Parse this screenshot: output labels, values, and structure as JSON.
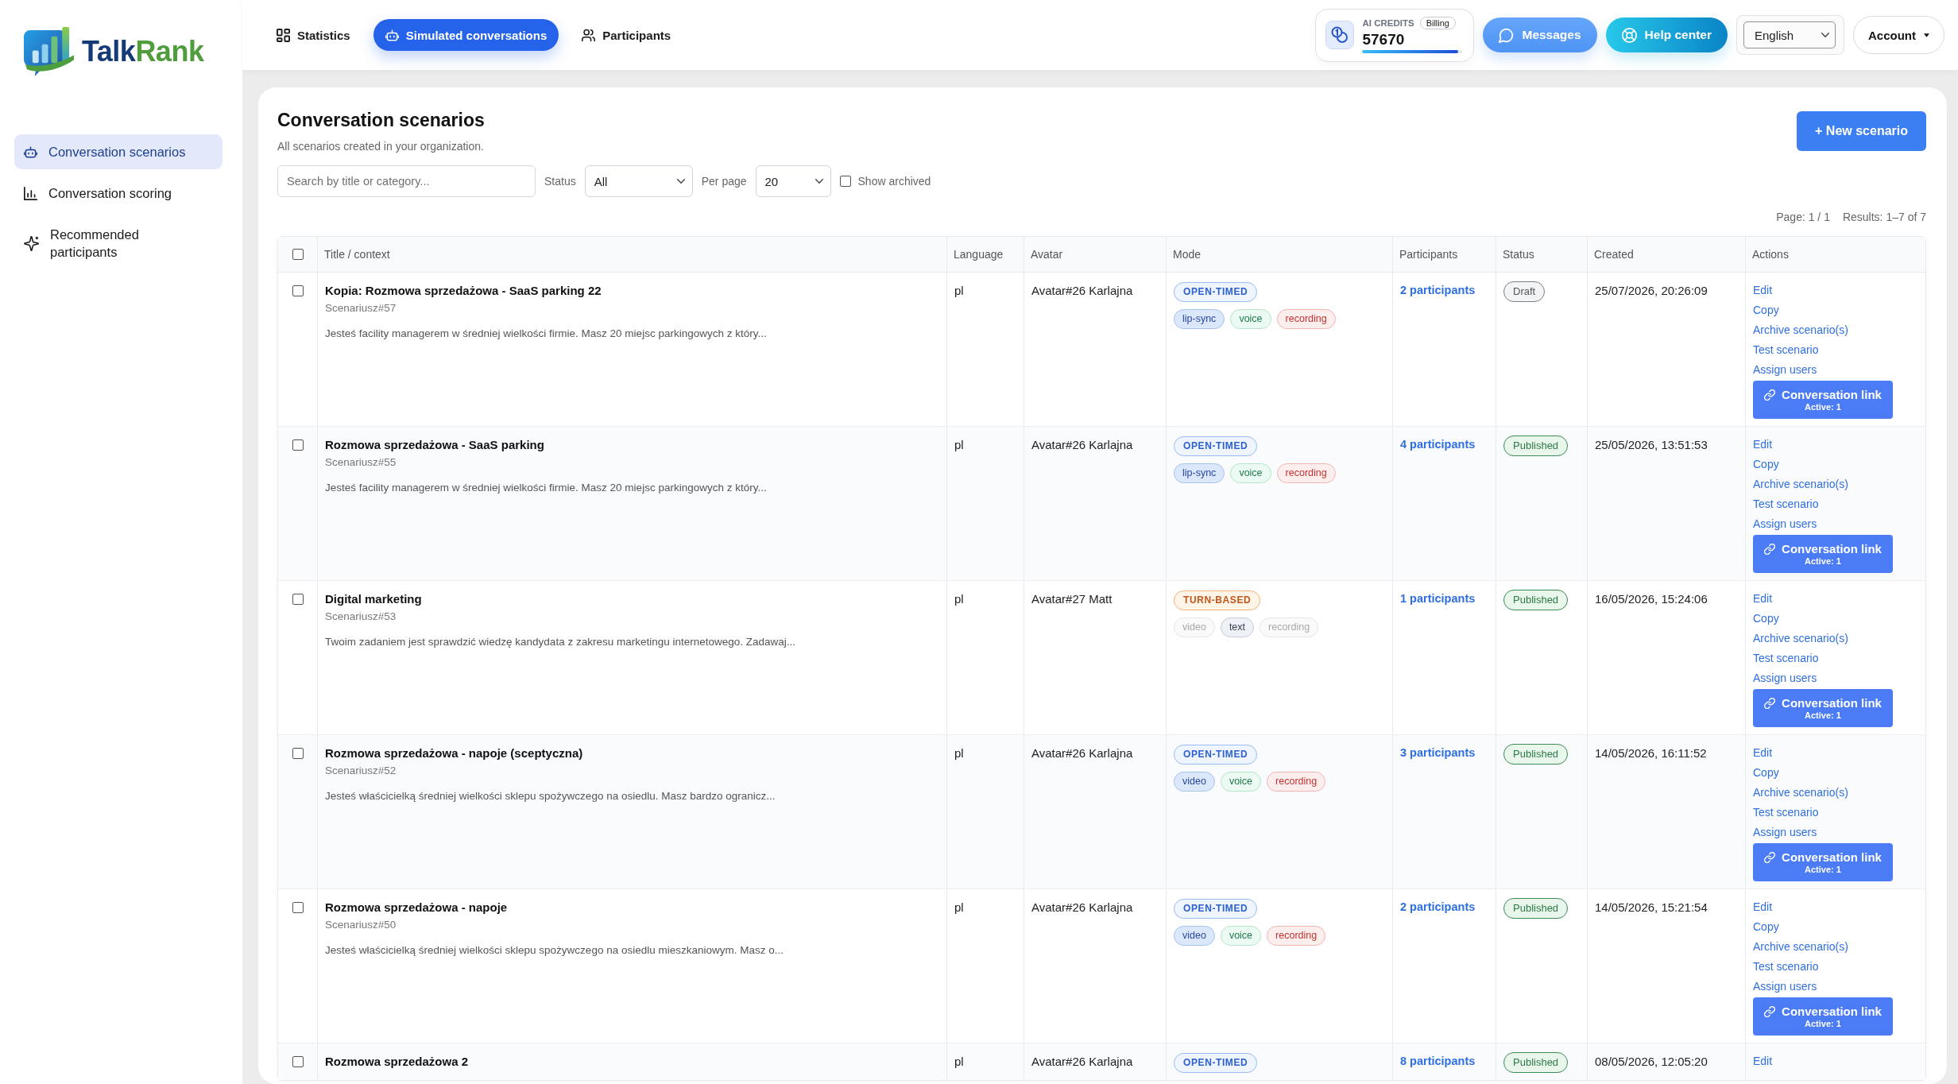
{
  "logo": {
    "wordmark": [
      "Talk",
      "Rank"
    ]
  },
  "nav": [
    {
      "label": "Statistics",
      "selected": false
    },
    {
      "label": "Simulated conversations",
      "selected": true
    },
    {
      "label": "Participants",
      "selected": false
    }
  ],
  "credits": {
    "label": "AI CREDITS",
    "billing": "Billing",
    "value": "57670",
    "level": 0.96
  },
  "header_buttons": [
    {
      "label": "Messages",
      "kind": "messages"
    },
    {
      "label": "Help center",
      "kind": "help"
    }
  ],
  "language": {
    "value": "English"
  },
  "account": {
    "label": "Account"
  },
  "sidebar": {
    "items": [
      {
        "label": "Conversation scenarios",
        "selected": true
      },
      {
        "label": "Conversation scoring",
        "selected": false
      },
      {
        "label": "Recommended participants",
        "selected": false
      }
    ]
  },
  "page": {
    "title": "Conversation scenarios",
    "subtitle": "All scenarios created in your organization.",
    "new_button": "+ New scenario"
  },
  "filters": {
    "search": {
      "placeholder": "Search by title or category..."
    },
    "status": {
      "label": "Status",
      "value": "All"
    },
    "per_page": {
      "label": "Per page",
      "value": "20"
    },
    "show_archived": {
      "label": "Show archived",
      "checked": false
    }
  },
  "pagination": {
    "page": "Page: 1 / 1",
    "results": "Results: 1–7 of 7"
  },
  "table": {
    "select_all": {
      "checked": false
    },
    "columns": [
      "Title / context",
      "Language",
      "Avatar",
      "Mode",
      "Participants",
      "Status",
      "Created",
      "Actions"
    ],
    "rows": [
      {
        "selected": false,
        "title": "Kopia: Rozmowa sprzedażowa - SaaS parking 22",
        "code": "Scenariusz#57",
        "description": "Jesteś facility managerem w średniej wielkości firmie. Masz 20 miejsc parkingowych z który...",
        "language": "pl",
        "avatar": "Avatar#26 Karlajna",
        "mode": {
          "label": "OPEN-TIMED",
          "kind": "open-timed"
        },
        "features": [
          {
            "label": "lip-sync",
            "kind": "visual",
            "on": true
          },
          {
            "label": "voice",
            "kind": "voice",
            "on": true
          },
          {
            "label": "recording",
            "kind": "recording",
            "on": true
          }
        ],
        "participants": "2 participants",
        "status": {
          "label": "Draft",
          "kind": "draft"
        },
        "created": "25/07/2026, 20:26:09",
        "actions": [
          "Edit",
          "Copy",
          "Archive scenario(s)",
          "Test scenario",
          "Assign users"
        ],
        "link_button": {
          "label": "Conversation link",
          "active": "Active: 1"
        }
      },
      {
        "selected": false,
        "title": "Rozmowa sprzedażowa - SaaS parking",
        "code": "Scenariusz#55",
        "description": "Jesteś facility managerem w średniej wielkości firmie. Masz 20 miejsc parkingowych z który...",
        "language": "pl",
        "avatar": "Avatar#26 Karlajna",
        "mode": {
          "label": "OPEN-TIMED",
          "kind": "open-timed"
        },
        "features": [
          {
            "label": "lip-sync",
            "kind": "visual",
            "on": true
          },
          {
            "label": "voice",
            "kind": "voice",
            "on": true
          },
          {
            "label": "recording",
            "kind": "recording",
            "on": true
          }
        ],
        "participants": "4 participants",
        "status": {
          "label": "Published",
          "kind": "published"
        },
        "created": "25/05/2026, 13:51:53",
        "actions": [
          "Edit",
          "Copy",
          "Archive scenario(s)",
          "Test scenario",
          "Assign users"
        ],
        "link_button": {
          "label": "Conversation link",
          "active": "Active: 1"
        }
      },
      {
        "selected": false,
        "title": "Digital marketing",
        "code": "Scenariusz#53",
        "description": "Twoim zadaniem jest sprawdzić wiedzę kandydata z zakresu marketingu internetowego. Zadawaj...",
        "language": "pl",
        "avatar": "Avatar#27 Matt",
        "mode": {
          "label": "TURN-BASED",
          "kind": "turn-based"
        },
        "features": [
          {
            "label": "video",
            "kind": "visual",
            "on": false
          },
          {
            "label": "text",
            "kind": "text",
            "on": true
          },
          {
            "label": "recording",
            "kind": "recording",
            "on": false
          }
        ],
        "participants": "1 participants",
        "status": {
          "label": "Published",
          "kind": "published"
        },
        "created": "16/05/2026, 15:24:06",
        "actions": [
          "Edit",
          "Copy",
          "Archive scenario(s)",
          "Test scenario",
          "Assign users"
        ],
        "link_button": {
          "label": "Conversation link",
          "active": "Active: 1"
        }
      },
      {
        "selected": false,
        "title": "Rozmowa sprzedażowa - napoje (sceptyczna)",
        "code": "Scenariusz#52",
        "description": "Jesteś właścicielką średniej wielkości sklepu spożywczego na osiedlu. Masz bardzo ogranicz...",
        "language": "pl",
        "avatar": "Avatar#26 Karlajna",
        "mode": {
          "label": "OPEN-TIMED",
          "kind": "open-timed"
        },
        "features": [
          {
            "label": "video",
            "kind": "visual",
            "on": true
          },
          {
            "label": "voice",
            "kind": "voice",
            "on": true
          },
          {
            "label": "recording",
            "kind": "recording",
            "on": true
          }
        ],
        "participants": "3 participants",
        "status": {
          "label": "Published",
          "kind": "published"
        },
        "created": "14/05/2026, 16:11:52",
        "actions": [
          "Edit",
          "Copy",
          "Archive scenario(s)",
          "Test scenario",
          "Assign users"
        ],
        "link_button": {
          "label": "Conversation link",
          "active": "Active: 1"
        }
      },
      {
        "selected": false,
        "title": "Rozmowa sprzedażowa - napoje",
        "code": "Scenariusz#50",
        "description": "Jesteś właścicielką średniej wielkości sklepu spożywczego na osiedlu mieszkaniowym. Masz o...",
        "language": "pl",
        "avatar": "Avatar#26 Karlajna",
        "mode": {
          "label": "OPEN-TIMED",
          "kind": "open-timed"
        },
        "features": [
          {
            "label": "video",
            "kind": "visual",
            "on": true
          },
          {
            "label": "voice",
            "kind": "voice",
            "on": true
          },
          {
            "label": "recording",
            "kind": "recording",
            "on": true
          }
        ],
        "participants": "2 participants",
        "status": {
          "label": "Published",
          "kind": "published"
        },
        "created": "14/05/2026, 15:21:54",
        "actions": [
          "Edit",
          "Copy",
          "Archive scenario(s)",
          "Test scenario",
          "Assign users"
        ],
        "link_button": {
          "label": "Conversation link",
          "active": "Active: 1"
        }
      },
      {
        "selected": false,
        "title": "Rozmowa sprzedażowa 2",
        "language": "pl",
        "avatar": "Avatar#26 Karlajna",
        "mode": {
          "label": "OPEN-TIMED",
          "kind": "open-timed"
        },
        "participants": "8 participants",
        "status": {
          "label": "Published",
          "kind": "published"
        },
        "created": "08/05/2026, 12:05:20",
        "actions": [
          "Edit"
        ]
      }
    ]
  }
}
